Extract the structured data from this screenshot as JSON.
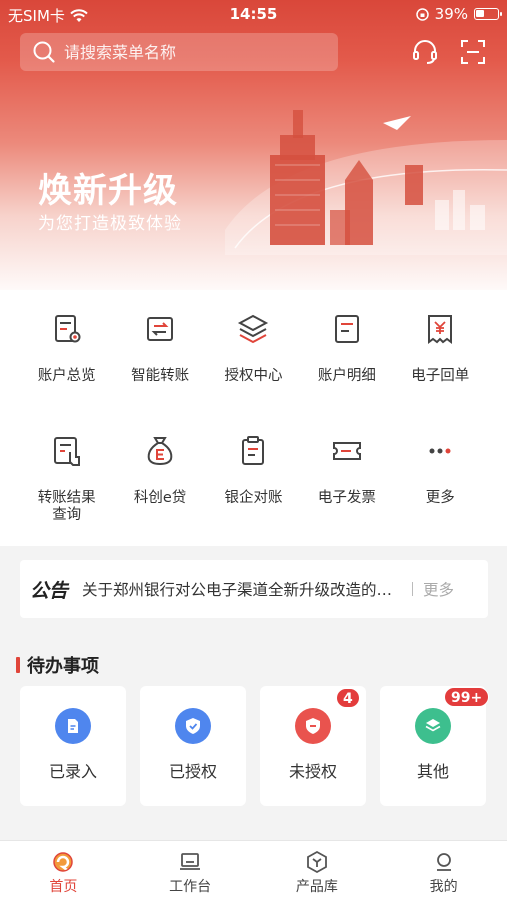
{
  "status_bar": {
    "carrier": "无SIM卡",
    "time": "14:55",
    "battery": "39%"
  },
  "search": {
    "placeholder": "请搜索菜单名称"
  },
  "banner": {
    "title": "焕新升级",
    "subtitle": "为您打造极致体验"
  },
  "menu": [
    {
      "label": "账户总览",
      "icon": "account-overview-icon"
    },
    {
      "label": "智能转账",
      "icon": "transfer-icon"
    },
    {
      "label": "授权中心",
      "icon": "layers-icon"
    },
    {
      "label": "账户明细",
      "icon": "account-detail-icon"
    },
    {
      "label": "电子回单",
      "icon": "receipt-icon"
    },
    {
      "label": "转账结果\n查询",
      "icon": "transfer-result-icon"
    },
    {
      "label": "科创e贷",
      "icon": "money-bag-icon"
    },
    {
      "label": "银企对账",
      "icon": "clipboard-icon"
    },
    {
      "label": "电子发票",
      "icon": "ticket-icon"
    },
    {
      "label": "更多",
      "icon": "more-icon"
    }
  ],
  "notice": {
    "tag": "公告",
    "text": "关于郑州银行对公电子渠道全新升级改造的公告",
    "more": "更多"
  },
  "todo": {
    "title": "待办事项",
    "items": [
      {
        "label": "已录入",
        "badge": "",
        "color": "#4f86ee"
      },
      {
        "label": "已授权",
        "badge": "",
        "color": "#4f86ee"
      },
      {
        "label": "未授权",
        "badge": "4",
        "color": "#e9534e"
      },
      {
        "label": "其他",
        "badge": "99+",
        "color": "#3dbf8e"
      }
    ]
  },
  "tabs": [
    {
      "label": "首页",
      "active": true
    },
    {
      "label": "工作台",
      "active": false
    },
    {
      "label": "产品库",
      "active": false
    },
    {
      "label": "我的",
      "active": false
    }
  ],
  "colors": {
    "accent": "#e0453a",
    "blue": "#4f86ee",
    "green": "#3dbf8e"
  }
}
